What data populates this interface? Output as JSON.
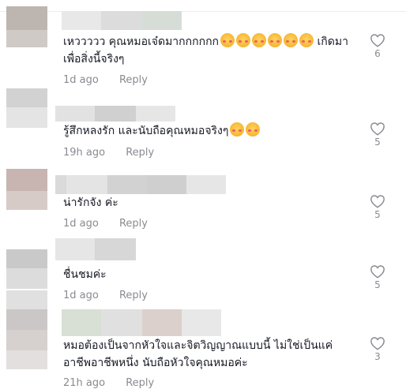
{
  "comments": [
    {
      "text": "เหววววว คุณหมอเจ๋ดมากกกกกก",
      "emoji_count": 6,
      "text_tail": " เกิดมาเพื่อสิ่งนี้จริงๆ",
      "time": "1d ago",
      "reply": "Reply",
      "likes": "6"
    },
    {
      "text": "รู้สึกหลงรัก และนับถือคุณหมอจริงๆ",
      "emoji_count": 2,
      "text_tail": "",
      "time": "19h ago",
      "reply": "Reply",
      "likes": "5"
    },
    {
      "text": "น่ารักจัง ค่ะ",
      "emoji_count": 0,
      "text_tail": "",
      "time": "1d ago",
      "reply": "Reply",
      "likes": "5"
    },
    {
      "text": "ชื่นชมค่ะ",
      "emoji_count": 0,
      "text_tail": "",
      "time": "1d ago",
      "reply": "Reply",
      "likes": "5"
    },
    {
      "text": "หมอต้องเป็นจากหัวใจและจิตวิญญาณแบบนี้ ไม่ใช่เป็นแค่อาชีพอาชีพหนึ่ง นับถือหัวใจคุณหมอค่ะ",
      "emoji_count": 0,
      "text_tail": "",
      "time": "21h ago",
      "reply": "Reply",
      "likes": "3"
    }
  ],
  "icons": {
    "like": "heart-outline-icon",
    "emoji": "smiling-face-with-hearts-emoji"
  },
  "colors": {
    "text": "#161823",
    "muted": "#8a8b91",
    "heart": "#8a8b91"
  }
}
